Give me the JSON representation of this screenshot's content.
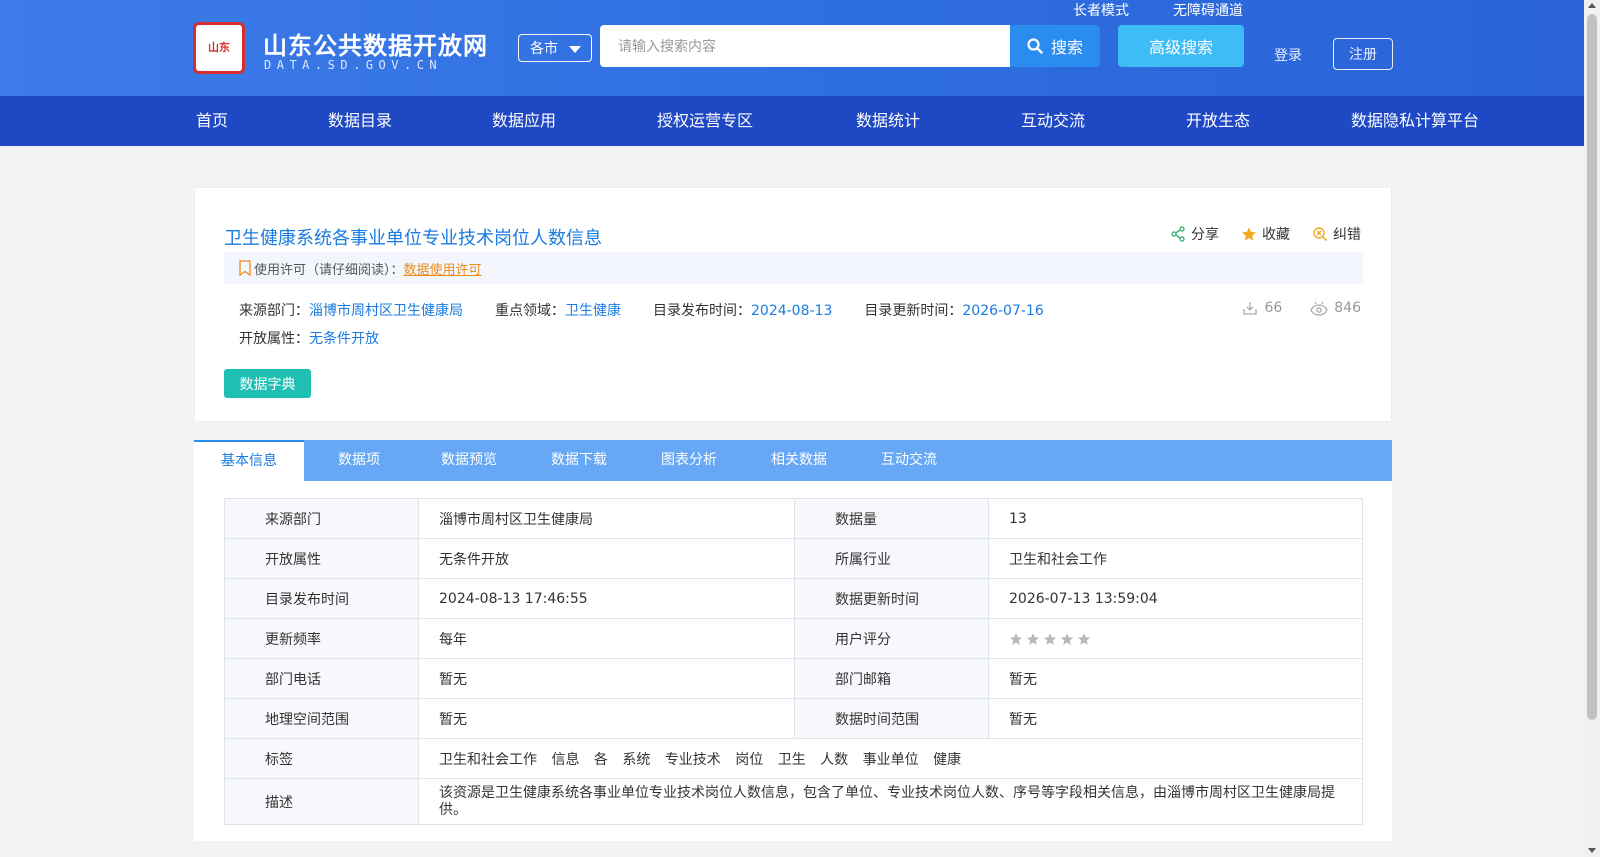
{
  "header": {
    "logo_seal": "山东",
    "logo_title": "山东公共数据开放网",
    "logo_sub": "DATA.SD.GOV.CN",
    "city_select": "各市",
    "search_placeholder": "请输入搜索内容",
    "search_label": "搜索",
    "advanced_search_label": "高级搜索",
    "elder_mode": "长者模式",
    "accessibility": "无障碍通道",
    "login": "登录",
    "register": "注册"
  },
  "nav": [
    "首页",
    "数据目录",
    "数据应用",
    "授权运营专区",
    "数据统计",
    "互动交流",
    "开放生态",
    "数据隐私计算平台"
  ],
  "dataset": {
    "title": "卫生健康系统各事业单位专业技术岗位人数信息",
    "actions": {
      "share": "分享",
      "favorite": "收藏",
      "correct": "纠错"
    },
    "license_label": "使用许可（请仔细阅读）：",
    "license_link": "数据使用许可",
    "source_label": "来源部门：",
    "source_value": "淄博市周村区卫生健康局",
    "domain_label": "重点领域：",
    "domain_value": "卫生健康",
    "publish_label": "目录发布时间：",
    "publish_value": "2024-08-13",
    "update_label": "目录更新时间：",
    "update_value": "2026-07-16",
    "open_label": "开放属性：",
    "open_value": "无条件开放",
    "downloads": "66",
    "views": "846",
    "dict_button": "数据字典"
  },
  "tabs": [
    "基本信息",
    "数据项",
    "数据预览",
    "数据下载",
    "图表分析",
    "相关数据",
    "互动交流"
  ],
  "info_table": {
    "rows": [
      {
        "k1": "来源部门",
        "v1": "淄博市周村区卫生健康局",
        "k2": "数据量",
        "v2": "13"
      },
      {
        "k1": "开放属性",
        "v1": "无条件开放",
        "k2": "所属行业",
        "v2": "卫生和社会工作"
      },
      {
        "k1": "目录发布时间",
        "v1": "2024-08-13 17:46:55",
        "k2": "数据更新时间",
        "v2": "2026-07-13 13:59:04"
      },
      {
        "k1": "更新频率",
        "v1": "每年",
        "k2": "用户评分",
        "v2": ""
      },
      {
        "k1": "部门电话",
        "v1": "暂无",
        "k2": "部门邮箱",
        "v2": "暂无"
      },
      {
        "k1": "地理空间范围",
        "v1": "暂无",
        "k2": "数据时间范围",
        "v2": "暂无"
      }
    ],
    "rating": 0,
    "tags_label": "标签",
    "tags": [
      "卫生和社会工作",
      "信息",
      "各",
      "系统",
      "专业技术",
      "岗位",
      "卫生",
      "人数",
      "事业单位",
      "健康"
    ],
    "desc_label": "描述",
    "desc": "该资源是卫生健康系统各事业单位专业技术岗位人数信息，包含了单位、专业技术岗位人数、序号等字段相关信息，由淄博市周村区卫生健康局提供。"
  }
}
